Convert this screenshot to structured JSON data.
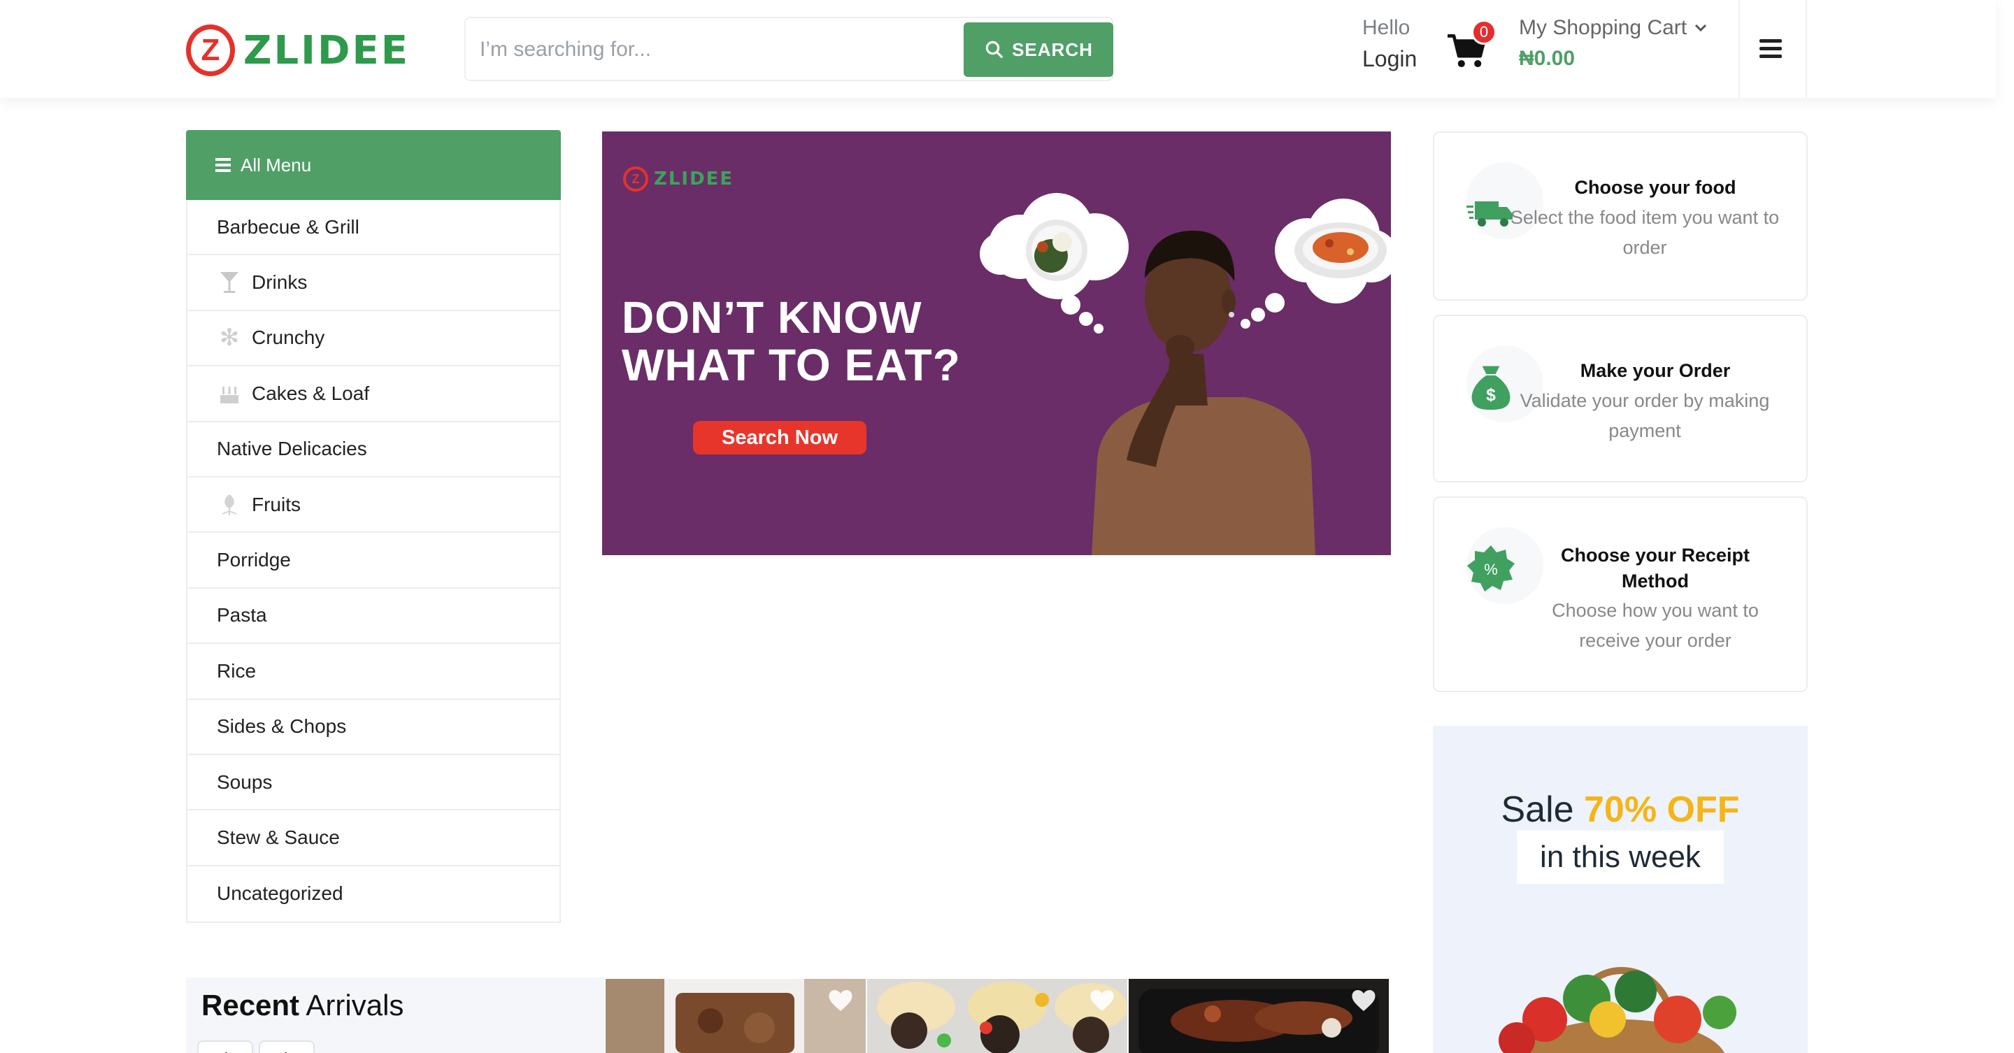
{
  "header": {
    "brand": "ZLIDEE",
    "search_placeholder": "I’m searching for...",
    "search_button": "SEARCH",
    "hello": "Hello",
    "login": "Login",
    "cart_count": "0",
    "cart_title": "My Shopping Cart",
    "cart_total": "₦0.00"
  },
  "menu": {
    "head": "All Menu",
    "items": [
      {
        "label": "Barbecue & Grill",
        "icon": ""
      },
      {
        "label": "Drinks",
        "icon": "cocktail-icon"
      },
      {
        "label": "Crunchy",
        "icon": "snowflake-icon"
      },
      {
        "label": "Cakes & Loaf",
        "icon": "cake-icon"
      },
      {
        "label": "Native Delicacies",
        "icon": ""
      },
      {
        "label": "Fruits",
        "icon": "leaf-icon"
      },
      {
        "label": "Porridge",
        "icon": ""
      },
      {
        "label": "Pasta",
        "icon": ""
      },
      {
        "label": "Rice",
        "icon": ""
      },
      {
        "label": "Sides & Chops",
        "icon": ""
      },
      {
        "label": "Soups",
        "icon": ""
      },
      {
        "label": "Stew & Sauce",
        "icon": ""
      },
      {
        "label": "Uncategorized",
        "icon": ""
      }
    ]
  },
  "banner": {
    "brand": "ZLIDEE",
    "headline_line1": "DON’T KNOW",
    "headline_line2": "WHAT TO EAT?",
    "button": "Search Now"
  },
  "steps": [
    {
      "title": "Choose your food",
      "desc": "Select the food item you want to order",
      "icon": "delivery-truck-icon"
    },
    {
      "title": "Make your Order",
      "desc": "Validate your order by making payment",
      "icon": "money-bag-icon"
    },
    {
      "title": "Choose your Receipt Method",
      "desc": "Choose how you want to receive your order",
      "icon": "discount-badge-icon"
    }
  ],
  "sale": {
    "prefix": "Sale",
    "highlight": "70% OFF",
    "line2": "in this week"
  },
  "recent": {
    "title_bold": "Recent",
    "title_rest": "Arrivals"
  },
  "colors": {
    "brand_green": "#4f9f67",
    "brand_red": "#e4322b",
    "banner_purple": "#6a2d67",
    "sale_yellow": "#f5b518"
  }
}
